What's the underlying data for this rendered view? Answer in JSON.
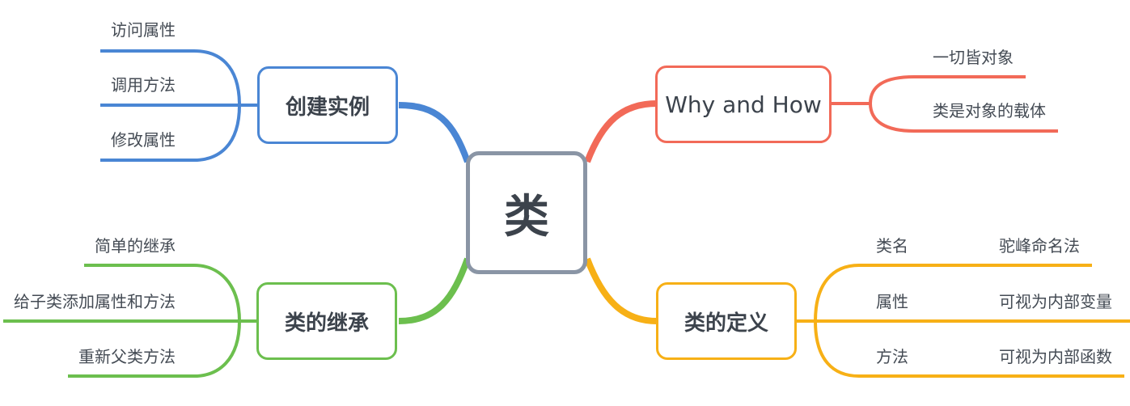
{
  "central": {
    "label": "类",
    "border_color": "#8a95a5"
  },
  "branches": [
    {
      "id": "create-instance",
      "label": "创建实例",
      "color": "#4a86d4",
      "children": [
        "访问属性",
        "调用方法",
        "修改属性"
      ]
    },
    {
      "id": "why-and-how",
      "label": "Why and How",
      "color": "#f26a58",
      "children": [
        "一切皆对象",
        "类是对象的载体"
      ]
    },
    {
      "id": "inheritance",
      "label": "类的继承",
      "color": "#6cbf4e",
      "children": [
        "简单的继承",
        "给子类添加属性和方法",
        "重新父类方法"
      ]
    },
    {
      "id": "definition",
      "label": "类的定义",
      "color": "#f7b016",
      "children": [
        {
          "key": "类名",
          "value": "驼峰命名法"
        },
        {
          "key": "属性",
          "value": "可视为内部变量"
        },
        {
          "key": "方法",
          "value": "可视为内部函数"
        }
      ]
    }
  ]
}
